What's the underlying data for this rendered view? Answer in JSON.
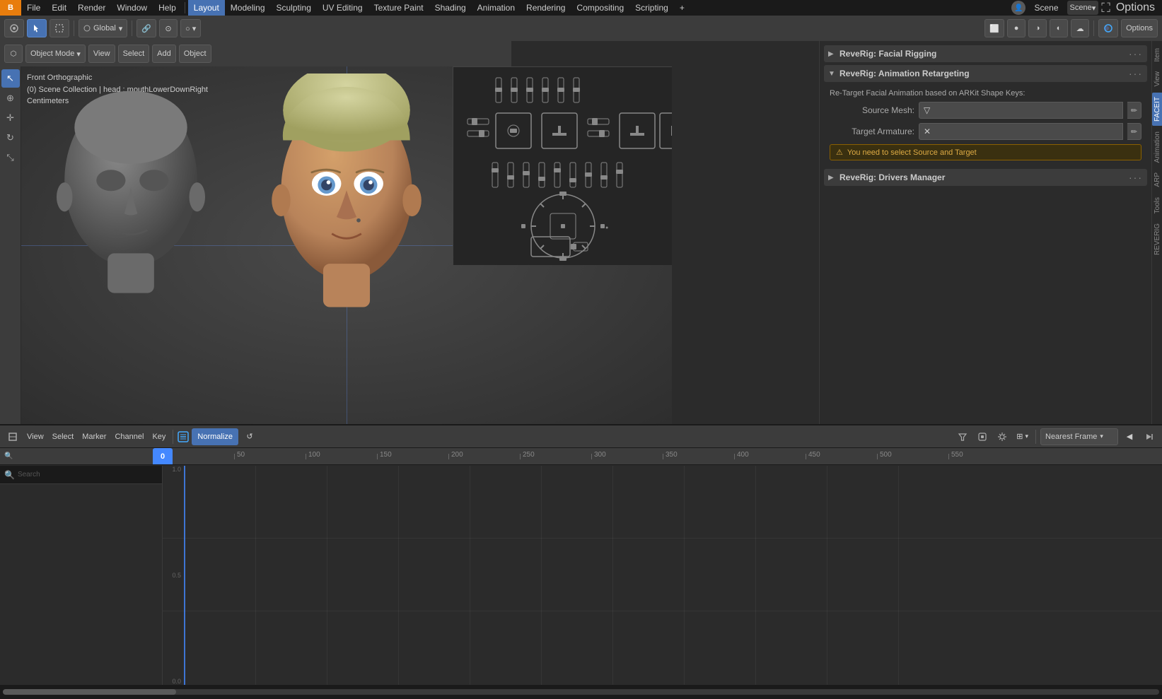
{
  "app": {
    "title": "Blender",
    "scene_name": "Scene"
  },
  "top_menu": {
    "logo": "B",
    "items": [
      {
        "label": "File",
        "id": "file"
      },
      {
        "label": "Edit",
        "id": "edit"
      },
      {
        "label": "Render",
        "id": "render"
      },
      {
        "label": "Window",
        "id": "window"
      },
      {
        "label": "Help",
        "id": "help"
      }
    ],
    "workspaces": [
      {
        "label": "Layout",
        "id": "layout",
        "active": true
      },
      {
        "label": "Modeling",
        "id": "modeling"
      },
      {
        "label": "Sculpting",
        "id": "sculpting"
      },
      {
        "label": "UV Editing",
        "id": "uv-editing"
      },
      {
        "label": "Texture Paint",
        "id": "texture-paint"
      },
      {
        "label": "Shading",
        "id": "shading"
      },
      {
        "label": "Animation",
        "id": "animation"
      },
      {
        "label": "Rendering",
        "id": "rendering"
      },
      {
        "label": "Compositing",
        "id": "compositing"
      },
      {
        "label": "Scripting",
        "id": "scripting"
      },
      {
        "label": "+",
        "id": "add-workspace"
      }
    ],
    "options_btn": "Options"
  },
  "viewport_header": {
    "mode": "Object Mode",
    "view_btn": "View",
    "select_btn": "Select",
    "add_btn": "Add",
    "object_btn": "Object"
  },
  "viewport_info": {
    "view_mode": "Front Orthographic",
    "collection": "(0) Scene Collection | head : mouthLowerDownRight",
    "units": "Centimeters"
  },
  "toolbar": {
    "transform_mode": "Global",
    "options_btn": "Options"
  },
  "right_panel": {
    "sections": [
      {
        "id": "facial-rigging",
        "title": "ReveRig: Facial Rigging",
        "expanded": false,
        "arrow": "▶"
      },
      {
        "id": "animation-retargeting",
        "title": "ReveRig: Animation Retargeting",
        "expanded": true,
        "arrow": "▼",
        "content": {
          "description": "Re-Target Facial Animation based on ARKit Shape Keys:",
          "source_mesh_label": "Source Mesh:",
          "source_mesh_icon": "▽",
          "target_armature_label": "Target Armature:",
          "target_armature_icon": "✕",
          "warning_text": "You need to select Source and Target"
        }
      },
      {
        "id": "drivers-manager",
        "title": "ReveRig: Drivers Manager",
        "expanded": false,
        "arrow": "▶"
      }
    ]
  },
  "right_sidebar": {
    "tabs": [
      {
        "label": "Item",
        "id": "item"
      },
      {
        "label": "View",
        "id": "view"
      },
      {
        "label": "FACEIT",
        "id": "faceit",
        "active": true
      },
      {
        "label": "Animation",
        "id": "animation"
      },
      {
        "label": "ARP",
        "id": "arp"
      },
      {
        "label": "Tools",
        "id": "tools"
      },
      {
        "label": "REVERIG",
        "id": "reverig"
      }
    ]
  },
  "timeline": {
    "toolbar": {
      "view_btn": "View",
      "select_btn": "Select",
      "marker_btn": "Marker",
      "channel_btn": "Channel",
      "key_btn": "Key",
      "normalize_btn": "Normalize",
      "interpolation_mode": "Nearest Frame"
    },
    "ruler": {
      "marks": [
        0,
        50,
        100,
        150,
        200,
        250,
        300,
        350,
        400,
        450,
        500,
        550
      ],
      "current_frame": 0
    },
    "axis_labels": [
      "1.0",
      "0.5",
      "0.0"
    ]
  }
}
